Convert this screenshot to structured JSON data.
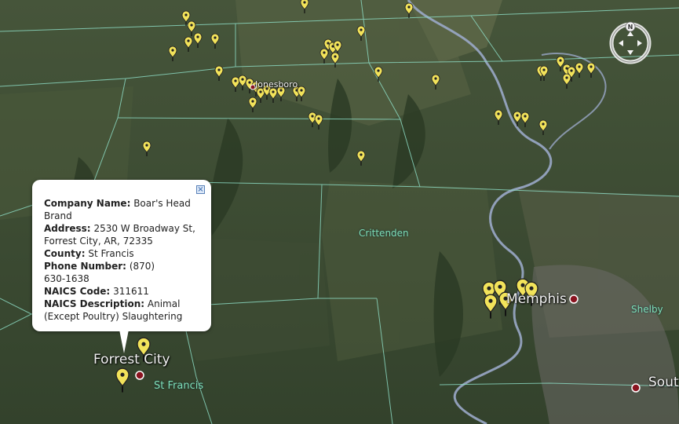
{
  "map": {
    "cities": [
      {
        "id": "jonesboro",
        "name": "Jonesboro"
      },
      {
        "id": "memphis",
        "name": "Memphis"
      },
      {
        "id": "forrest-city",
        "name": "Forrest City"
      },
      {
        "id": "south",
        "name": "Sout"
      }
    ],
    "counties": [
      {
        "id": "crittenden",
        "name": "Crittenden"
      },
      {
        "id": "shelby",
        "name": "Shelby"
      },
      {
        "id": "st-francis",
        "name": "St Francis"
      }
    ],
    "colors": {
      "terrain": "#3e4c33",
      "border": "#8fe0c8",
      "river": "#9aa8c8",
      "placemark": "#f2e35a",
      "city_dot": "#8a1420"
    }
  },
  "popup": {
    "company_label": "Company Name:",
    "company_value": "Boar's Head",
    "company_value_2": "Brand",
    "address_label": "Address:",
    "address_value": "2530 W Broadway St,",
    "address_value_2": "Forrest City, AR, 72335",
    "county_label": "County:",
    "county_value": "St Francis",
    "phone_label": "Phone Number:",
    "phone_value": "(870)",
    "phone_value_2": "630-1638",
    "naics_code_label": "NAICS Code:",
    "naics_code_value": "311611",
    "naics_desc_label": "NAICS Description:",
    "naics_desc_value": "Animal",
    "naics_desc_value_2": "(Except Poultry) Slaughtering",
    "close_symbol": "×"
  },
  "compass": {
    "north_label": "N"
  }
}
